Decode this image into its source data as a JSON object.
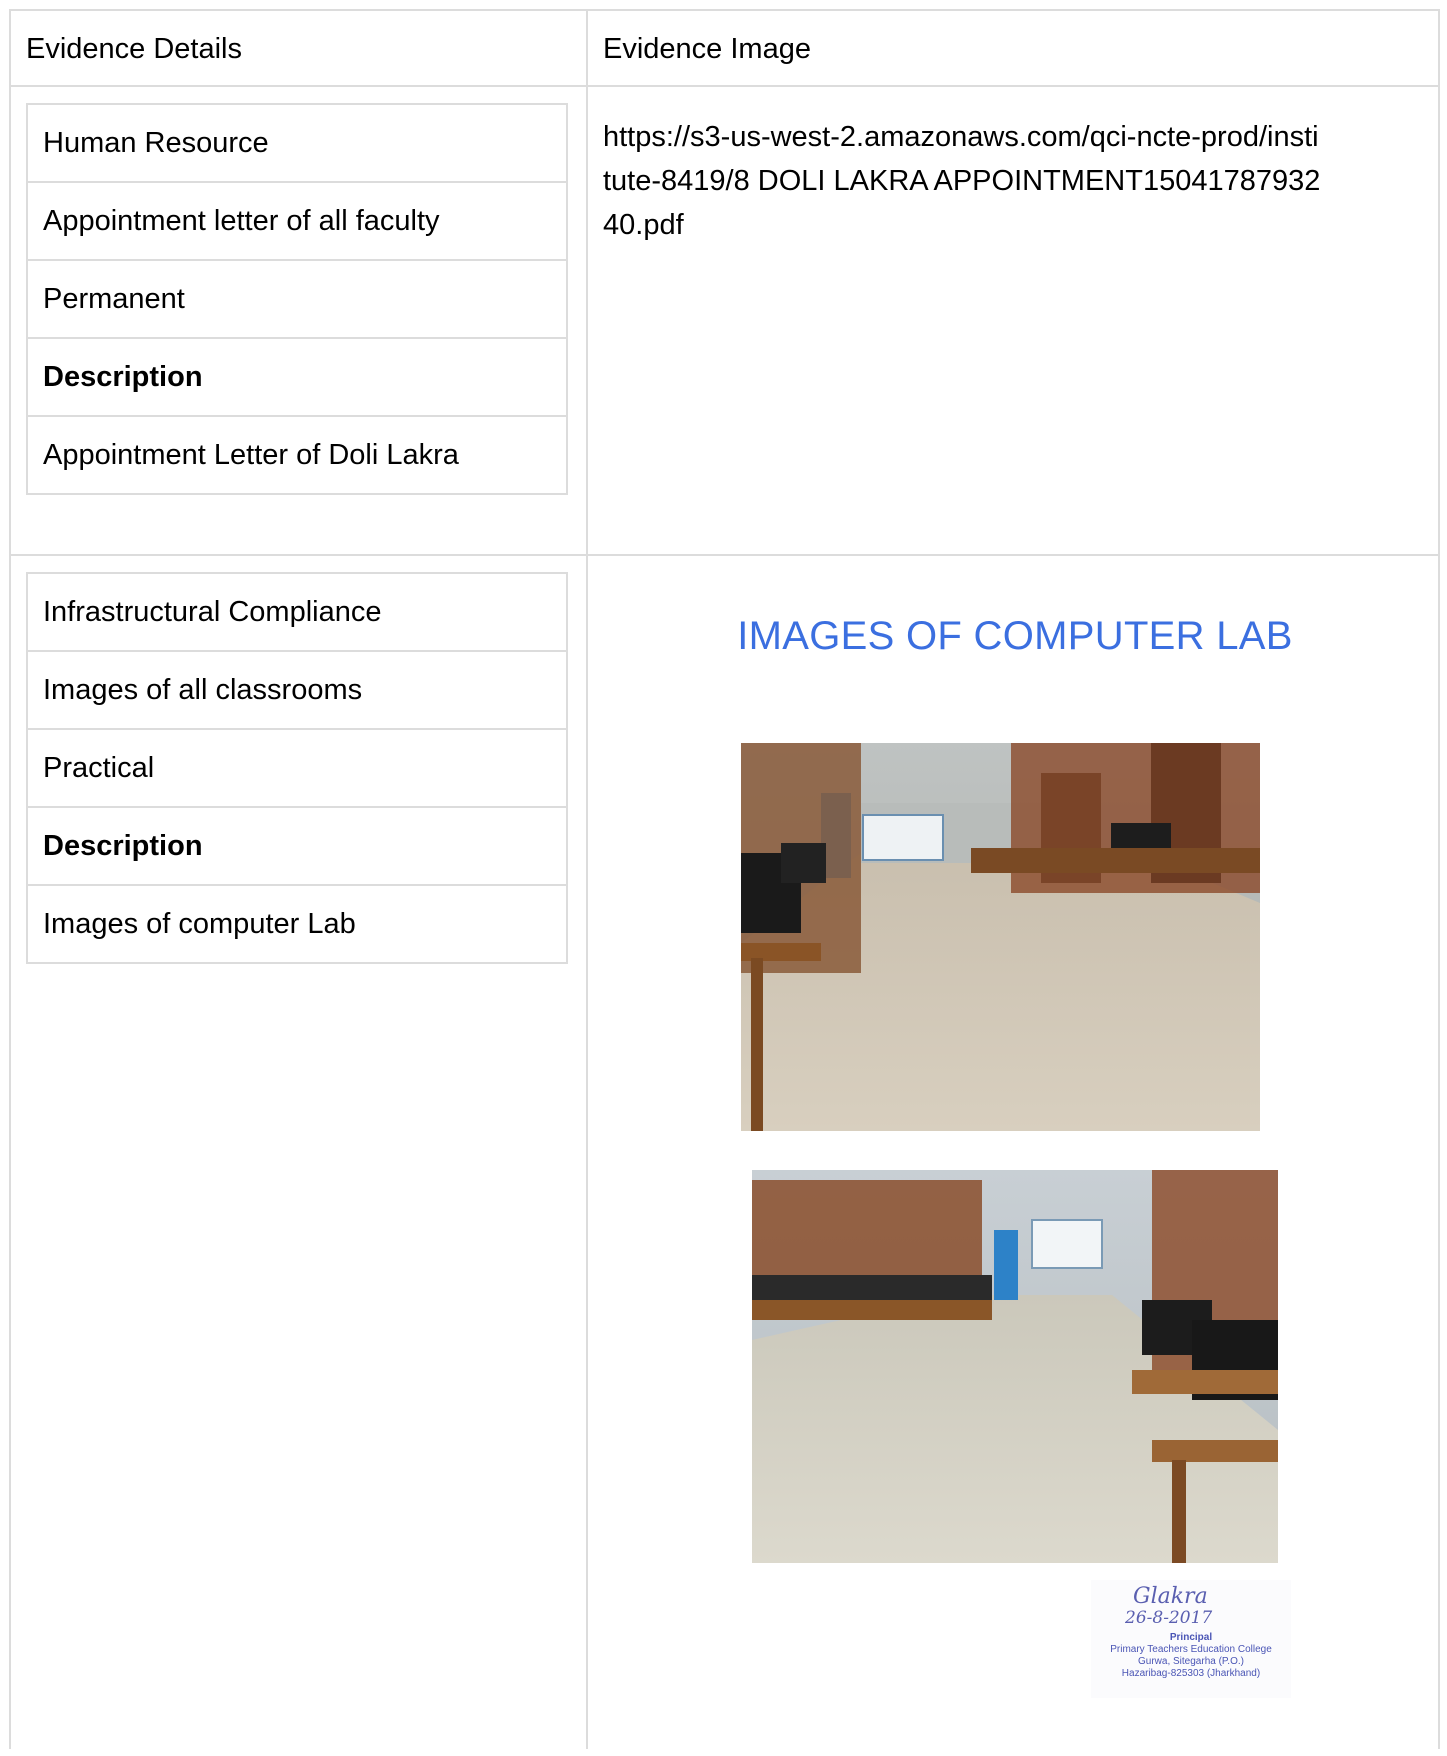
{
  "header": {
    "details_label": "Evidence Details",
    "image_label": "Evidence Image"
  },
  "rows": [
    {
      "details": [
        {
          "text": "Human Resource",
          "bold": false
        },
        {
          "text": "Appointment letter of all faculty",
          "bold": false
        },
        {
          "text": "Permanent",
          "bold": false
        },
        {
          "text": "Description",
          "bold": true
        },
        {
          "text": "Appointment Letter of Doli Lakra",
          "bold": false
        }
      ],
      "evidence_link": "https://s3-us-west-2.amazonaws.com/qci-ncte-prod/institute-8419/8 DOLI LAKRA APPOINTMENT1504178793240.pdf"
    },
    {
      "details": [
        {
          "text": "Infrastructural Compliance",
          "bold": false
        },
        {
          "text": "Images of all classrooms",
          "bold": false
        },
        {
          "text": "Practical",
          "bold": false
        },
        {
          "text": "Description",
          "bold": true
        },
        {
          "text": "Images of computer Lab",
          "bold": false
        }
      ],
      "evidence_image_title": "IMAGES OF COMPUTER LAB",
      "stamp": {
        "signature": "Glakra",
        "date": "26-8-2017",
        "title": "Principal",
        "org": "Primary Teachers Education College",
        "address1": "Gurwa, Sitegarha (P.O.)",
        "address2": "Hazaribag-825303 (Jharkhand)"
      }
    }
  ],
  "colors": {
    "border": "#dcdcdc",
    "title_blue": "#3b6fe0",
    "stamp_ink": "#4a55b5"
  }
}
